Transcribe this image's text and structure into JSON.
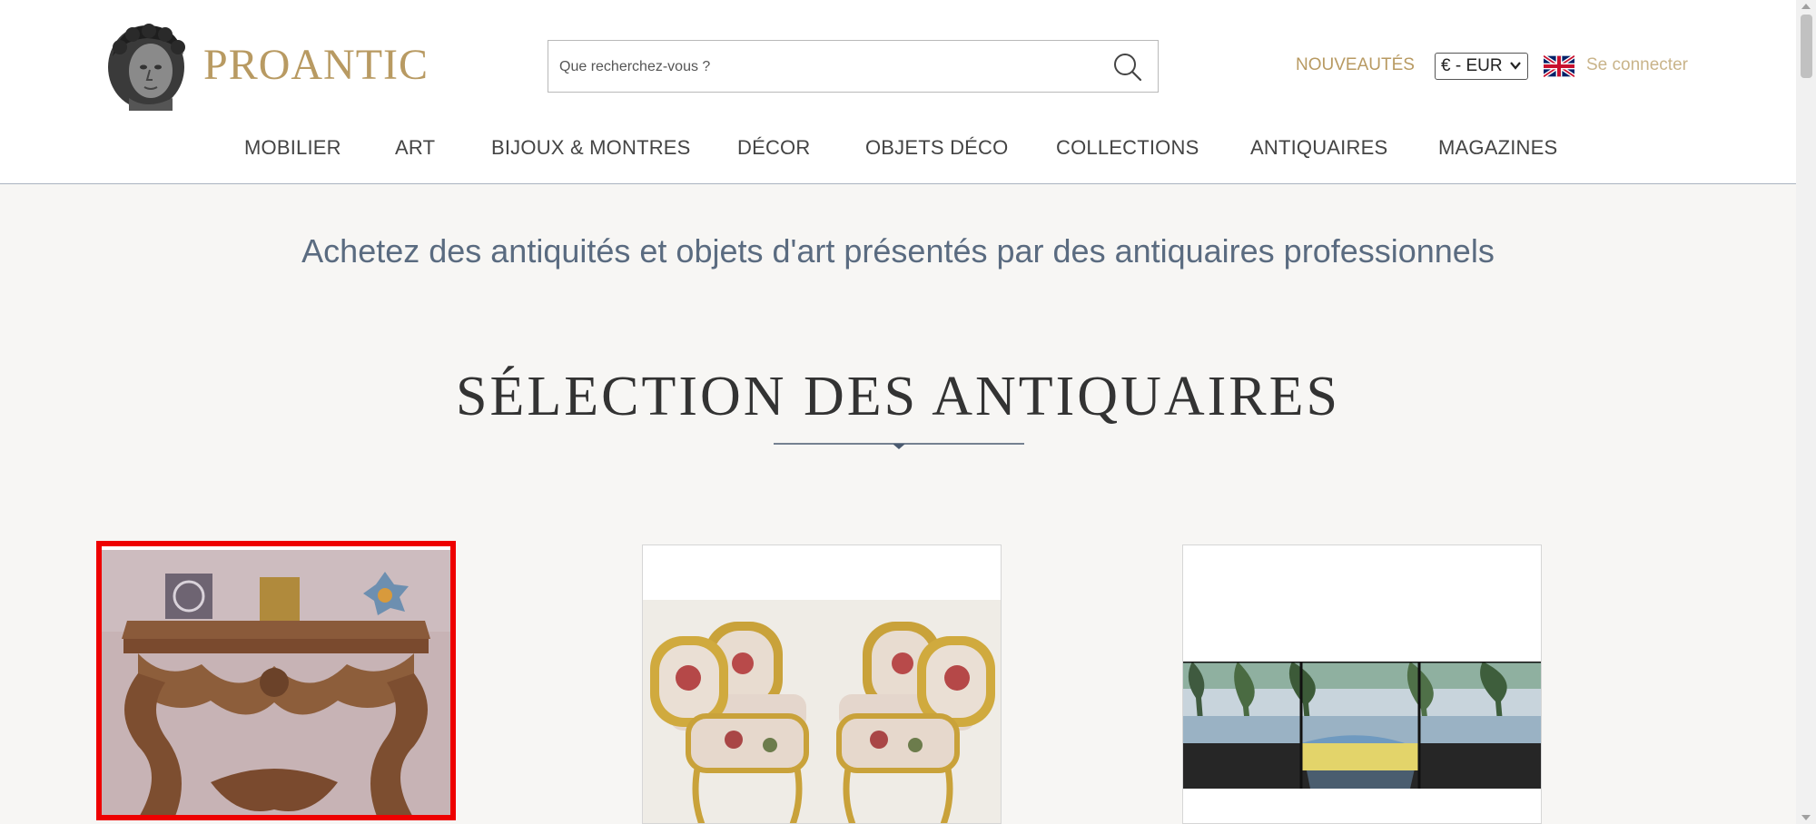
{
  "header": {
    "brand": "PROANTIC",
    "search": {
      "placeholder": "Que recherchez-vous ?",
      "value": ""
    },
    "nouveautes_label": "NOUVEAUTÉS",
    "currency": "€ - EUR",
    "login_label": "Se connecter",
    "icons": {
      "search": "search-icon",
      "flag": "uk-flag-icon",
      "logo": "bust-logo-icon"
    }
  },
  "nav": {
    "items": [
      {
        "label": "MOBILIER"
      },
      {
        "label": "ART"
      },
      {
        "label": "BIJOUX & MONTRES"
      },
      {
        "label": "DÉCOR"
      },
      {
        "label": "OBJETS DÉCO"
      },
      {
        "label": "COLLECTIONS"
      },
      {
        "label": "ANTIQUAIRES"
      },
      {
        "label": "MAGAZINES"
      }
    ]
  },
  "main": {
    "tagline": "Achetez des antiquités et objets d'art présentés par des antiquaires professionnels",
    "section_title": "SÉLECTION DES ANTIQUAIRES",
    "cards": [
      {
        "image": "carved-console-table",
        "selected": true
      },
      {
        "image": "gilded-armchairs-set",
        "selected": false
      },
      {
        "image": "stained-glass-panel",
        "selected": false
      }
    ]
  },
  "colors": {
    "brand_gold": "#b89a62",
    "tagline_blue": "#5a6b80",
    "selection_red": "#ee0000",
    "background": "#f7f6f4"
  }
}
